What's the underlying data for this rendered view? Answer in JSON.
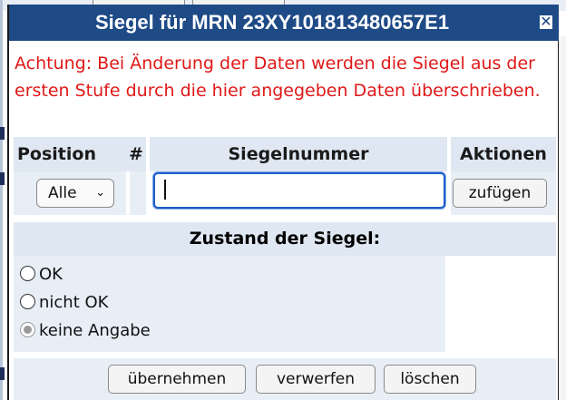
{
  "dialog": {
    "title": "Siegel für MRN 23XY101813480657E1",
    "close_glyph": "✕",
    "warning": "Achtung: Bei Änderung der Daten werden die Siegel aus der ersten Stufe durch die hier angegeben Daten überschrieben."
  },
  "table": {
    "headers": {
      "position": "Position",
      "hash": "#",
      "seal_number": "Siegelnummer",
      "actions": "Aktionen"
    },
    "position_select": {
      "value": "Alle"
    },
    "seal_input": {
      "value": "",
      "placeholder": ""
    },
    "add_button": "zufügen"
  },
  "condition": {
    "heading": "Zustand der Siegel:",
    "options": [
      {
        "label": "OK",
        "checked": false
      },
      {
        "label": "nicht OK",
        "checked": false
      },
      {
        "label": "keine Angabe",
        "checked": true
      }
    ]
  },
  "footer": {
    "apply_button": "übernehmen",
    "discard_button": "verwerfen",
    "delete_button": "löschen"
  },
  "colors": {
    "titlebar": "#1e4a86",
    "warning_text": "#e01818",
    "header_bg": "#dfe7f2",
    "row_bg": "#e8eef6",
    "focus_border": "#1f5dc8"
  }
}
